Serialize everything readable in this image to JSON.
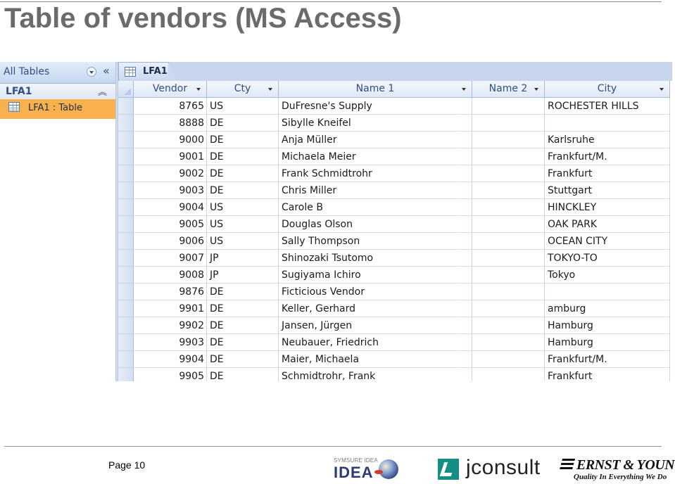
{
  "slide": {
    "title": "Table of vendors (MS Access)",
    "page_label": "Page 10"
  },
  "nav_pane": {
    "header": "All Tables",
    "group": "LFA1",
    "items": [
      {
        "label": "LFA1 : Table",
        "icon": "table-icon"
      }
    ]
  },
  "document": {
    "tab": "LFA1",
    "columns": [
      "Vendor",
      "Cty",
      "Name 1",
      "Name 2",
      "City"
    ],
    "rows": [
      [
        "8765",
        "US",
        "DuFresne's Supply",
        "",
        "ROCHESTER HILLS"
      ],
      [
        "8888",
        "DE",
        "Sibylle Kneifel",
        "",
        ""
      ],
      [
        "9000",
        "DE",
        "Anja Müller",
        "",
        "Karlsruhe"
      ],
      [
        "9001",
        "DE",
        "Michaela Meier",
        "",
        "Frankfurt/M."
      ],
      [
        "9002",
        "DE",
        "Frank Schmidtrohr",
        "",
        "Frankfurt"
      ],
      [
        "9003",
        "DE",
        "Chris Miller",
        "",
        "Stuttgart"
      ],
      [
        "9004",
        "US",
        "Carole B",
        "",
        "HINCKLEY"
      ],
      [
        "9005",
        "US",
        "Douglas Olson",
        "",
        "OAK PARK"
      ],
      [
        "9006",
        "US",
        "Sally Thompson",
        "",
        "OCEAN CITY"
      ],
      [
        "9007",
        "JP",
        "Shinozaki Tsutomo",
        "",
        "TOKYO-TO"
      ],
      [
        "9008",
        "JP",
        "Sugiyama Ichiro",
        "",
        "Tokyo"
      ],
      [
        "9876",
        "DE",
        "Ficticious Vendor",
        "",
        ""
      ],
      [
        "9901",
        "DE",
        "Keller, Gerhard",
        "",
        "amburg"
      ],
      [
        "9902",
        "DE",
        "Jansen, Jürgen",
        "",
        "Hamburg"
      ],
      [
        "9903",
        "DE",
        "Neubauer, Friedrich",
        "",
        "Hamburg"
      ],
      [
        "9904",
        "DE",
        "Maier, Michaela",
        "",
        "Frankfurt/M."
      ],
      [
        "9905",
        "DE",
        "Schmidtrohr, Frank",
        "",
        "Frankfurt"
      ]
    ]
  },
  "footer": {
    "logos": {
      "idea_super": "SYMSURE IDEA",
      "idea": "IDEA",
      "jconsult": "jconsult",
      "ey_name": "ERNST & YOUNG",
      "ey_tagline": "Quality In Everything We Do"
    }
  },
  "colors": {
    "title_gray": "#6b6b6b",
    "nav_selected": "#f9b14d",
    "access_blue": "#2f4e86",
    "jconsult_teal": "#158f86"
  }
}
